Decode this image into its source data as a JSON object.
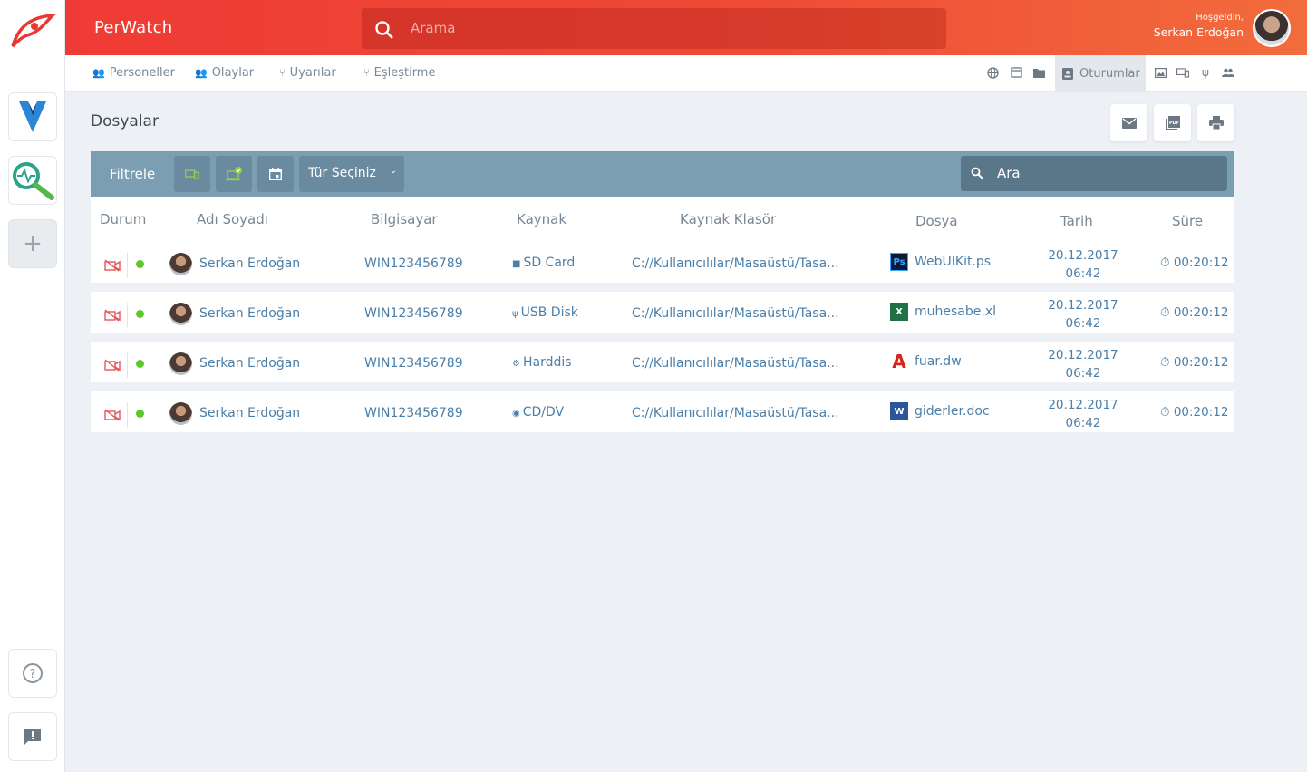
{
  "header": {
    "brand": "PerWatch",
    "search_placeholder": "Arama",
    "welcome": "Hoşgeldin,",
    "user_name": "Serkan Erdoğan"
  },
  "subnav": {
    "items": [
      "Personeller",
      "Olaylar",
      "Uyarılar",
      "Eşleştirme"
    ],
    "active_tab": "Oturumlar"
  },
  "page": {
    "title": "Dosyalar"
  },
  "filter": {
    "label": "Filtrele",
    "type_select": "Tür Seçiniz",
    "search_placeholder": "Ara"
  },
  "table": {
    "columns": [
      "Durum",
      "Adı Soyadı",
      "Bilgisayar",
      "Kaynak",
      "Kaynak Klasör",
      "Dosya",
      "Tarih",
      "Süre"
    ],
    "rows": [
      {
        "name": "Serkan Erdoğan",
        "computer": "WIN123456789",
        "source": "SD Card",
        "source_icon": "sd-card-icon",
        "folder": "C://Kullanıcılılar/Masaüstü/Tasa...",
        "file": "WebUIKit.ps",
        "file_icon": "photoshop-icon",
        "date": "20.12.2017",
        "time": "06:42",
        "duration": "00:20:12"
      },
      {
        "name": "Serkan Erdoğan",
        "computer": "WIN123456789",
        "source": "USB Disk",
        "source_icon": "usb-icon",
        "folder": "C://Kullanıcılılar/Masaüstü/Tasa...",
        "file": "muhesabe.xl",
        "file_icon": "excel-icon",
        "date": "20.12.2017",
        "time": "06:42",
        "duration": "00:20:12"
      },
      {
        "name": "Serkan Erdoğan",
        "computer": "WIN123456789",
        "source": "Harddis",
        "source_icon": "harddisk-icon",
        "folder": "C://Kullanıcılılar/Masaüstü/Tasa...",
        "file": "fuar.dw",
        "file_icon": "acrobat-icon",
        "date": "20.12.2017",
        "time": "06:42",
        "duration": "00:20:12"
      },
      {
        "name": "Serkan Erdoğan",
        "computer": "WIN123456789",
        "source": "CD/DV",
        "source_icon": "cd-icon",
        "folder": "C://Kullanıcılılar/Masaüstü/Tasa...",
        "file": "giderler.doc",
        "file_icon": "word-icon",
        "date": "20.12.2017",
        "time": "06:42",
        "duration": "00:20:12"
      }
    ]
  },
  "colors": {
    "header_start": "#ef3b35",
    "header_end": "#f26c3c",
    "filter_bar": "#7b9eb3",
    "link_text": "#4a7fa9",
    "status_online": "#5cc92a"
  }
}
